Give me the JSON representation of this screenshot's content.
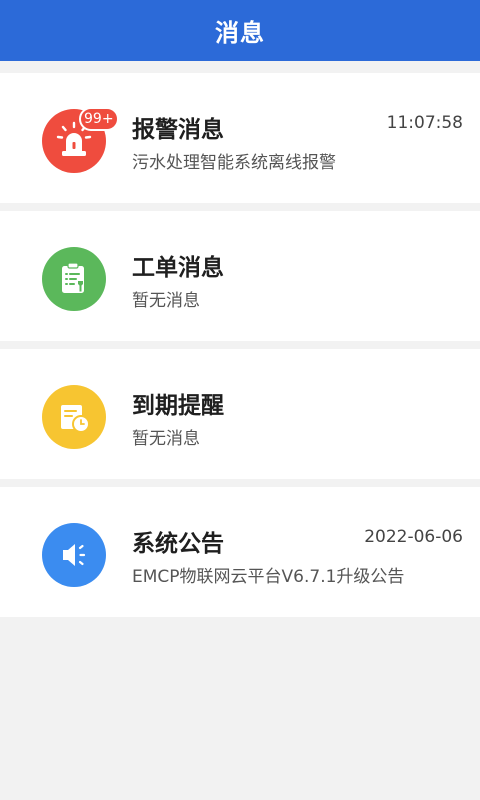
{
  "header": {
    "title": "消息"
  },
  "messages": [
    {
      "icon": "alarm-icon",
      "icon_color": "#ef4c3e",
      "badge": "99+",
      "title": "报警消息",
      "subtitle": "污水处理智能系统离线报警",
      "time": "11:07:58"
    },
    {
      "icon": "work-order-icon",
      "icon_color": "#5bb85b",
      "title": "工单消息",
      "subtitle": "暂无消息",
      "time": ""
    },
    {
      "icon": "expiry-reminder-icon",
      "icon_color": "#f7c531",
      "title": "到期提醒",
      "subtitle": "暂无消息",
      "time": ""
    },
    {
      "icon": "announcement-icon",
      "icon_color": "#3b8cf0",
      "title": "系统公告",
      "subtitle": "EMCP物联网云平台V6.7.1升级公告",
      "time": "2022-06-06"
    }
  ]
}
